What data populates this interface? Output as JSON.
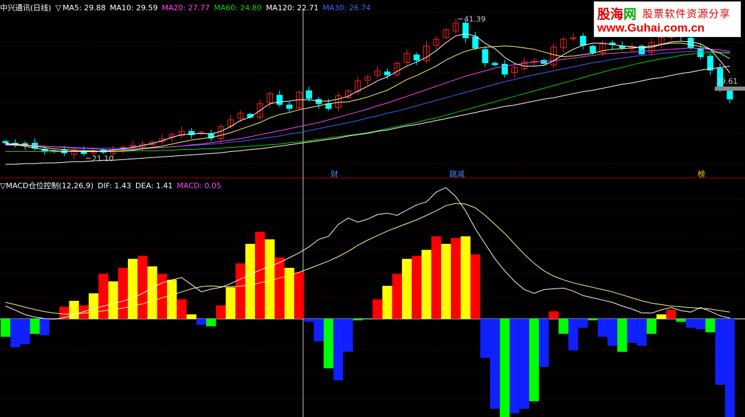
{
  "logo": {
    "brand_a": "股海",
    "brand_b": "网",
    "tagline": "股票软件资源分享",
    "url": "www.Guhai.com.cn"
  },
  "top_header": {
    "title": "中兴通讯(日线)",
    "arrow": "▽",
    "indicators": [
      {
        "label": "MA5: 29.88",
        "color": "#ffffff"
      },
      {
        "label": "MA10: 29.59",
        "color": "#ffffff"
      },
      {
        "label": "MA20: 27.77",
        "color": "#ff44ff"
      },
      {
        "label": "MA60: 24.80",
        "color": "#00dd00"
      },
      {
        "label": "MA120: 22.71",
        "color": "#ffffff"
      },
      {
        "label": "MA30: 26.74",
        "color": "#4466ff"
      }
    ]
  },
  "bottom_header": {
    "arrow": "▽",
    "title": "MACD仓位控制",
    "params": "(12,26,9)",
    "dif": "DIF: 1.43",
    "dea": "DEA: 1.41",
    "macd": "MACD: 0.05",
    "macd_color": "#ff44ff"
  },
  "markers": [
    {
      "text": "财",
      "color": "#4488ff"
    },
    {
      "text": "跳减",
      "color": "#4488ff"
    },
    {
      "text": "榜",
      "color": "#ffcc00"
    }
  ],
  "price_notes": {
    "high": "41.39",
    "low": "21.10",
    "last": "39.61"
  },
  "colors": {
    "up": "#ff2020",
    "down": "#00ffff",
    "hist_up_a": "#ff0000",
    "hist_up_b": "#ffff00",
    "hist_dn_a": "#1020ff",
    "hist_dn_b": "#00ff00",
    "ma5": "#ffffff",
    "ma10": "#ffff66",
    "ma20": "#ff44ff",
    "ma30": "#4466ff",
    "ma60": "#00dd00",
    "ma120": "#ffffff",
    "grid": "#8a0000"
  },
  "chart_data": [
    {
      "type": "candlestick",
      "title": "中兴通讯(日线)",
      "ylim": [
        19.5,
        43.0
      ],
      "close": [
        23.2,
        23.0,
        22.9,
        22.4,
        22.0,
        21.9,
        21.7,
        22.0,
        21.6,
        21.9,
        21.8,
        22.2,
        22.5,
        22.8,
        23.0,
        23.3,
        23.8,
        24.4,
        24.9,
        24.4,
        24.8,
        23.9,
        25.6,
        26.6,
        27.6,
        27.0,
        29.0,
        30.5,
        28.9,
        28.3,
        30.7,
        29.8,
        29.0,
        28.3,
        30.2,
        30.9,
        32.4,
        33.0,
        33.9,
        33.3,
        35.0,
        36.5,
        35.5,
        37.6,
        38.6,
        40.0,
        41.0,
        38.8,
        37.3,
        35.1,
        34.8,
        33.4,
        34.4,
        35.2,
        35.3,
        35.0,
        37.4,
        38.6,
        38.8,
        37.7,
        36.6,
        37.9,
        37.8,
        37.3,
        37.5,
        36.4,
        38.1,
        38.9,
        39.0,
        39.0,
        37.3,
        36.0,
        34.0,
        31.1,
        29.7
      ],
      "ma5": [
        23.0,
        22.9,
        22.7,
        22.4,
        22.2,
        22.0,
        21.9,
        21.9,
        21.9,
        21.9,
        21.9,
        22.1,
        22.3,
        22.5,
        22.8,
        23.1,
        23.5,
        24.0,
        24.4,
        24.5,
        24.6,
        24.5,
        24.9,
        25.6,
        26.5,
        27.0,
        28.0,
        29.0,
        29.3,
        29.4,
        29.6,
        29.6,
        29.4,
        29.4,
        29.7,
        30.1,
        30.9,
        31.6,
        32.4,
        33.0,
        33.8,
        34.6,
        35.2,
        35.9,
        36.9,
        38.1,
        39.1,
        39.4,
        39.1,
        38.0,
        37.2,
        35.9,
        35.0,
        34.6,
        34.6,
        34.7,
        35.4,
        36.3,
        37.1,
        37.7,
        38.0,
        38.0,
        37.8,
        37.6,
        37.5,
        37.3,
        37.4,
        37.8,
        38.2,
        38.3,
        38.2,
        37.9,
        37.1,
        35.4,
        33.6
      ],
      "ma10": [
        23.1,
        23.0,
        22.9,
        22.7,
        22.5,
        22.3,
        22.2,
        22.1,
        22.0,
        22.0,
        21.9,
        21.9,
        22.0,
        22.1,
        22.3,
        22.5,
        22.7,
        23.0,
        23.3,
        23.6,
        23.8,
        24.0,
        24.3,
        24.7,
        25.2,
        25.7,
        26.2,
        26.9,
        27.4,
        27.7,
        28.1,
        28.4,
        28.7,
        29.0,
        29.2,
        29.3,
        29.6,
        30.0,
        30.5,
        31.0,
        31.8,
        32.6,
        33.2,
        33.9,
        34.6,
        35.5,
        36.2,
        36.8,
        37.2,
        37.4,
        37.5,
        37.6,
        37.5,
        37.3,
        37.1,
        36.7,
        36.3,
        36.0,
        36.1,
        36.3,
        36.5,
        36.9,
        37.1,
        37.2,
        37.3,
        37.4,
        37.6,
        37.8,
        38.0,
        38.0,
        37.8,
        37.5,
        37.1,
        36.5,
        35.7
      ],
      "ma20": [
        22.9,
        22.9,
        22.8,
        22.8,
        22.7,
        22.6,
        22.5,
        22.4,
        22.3,
        22.3,
        22.2,
        22.2,
        22.2,
        22.2,
        22.3,
        22.4,
        22.5,
        22.6,
        22.7,
        22.9,
        23.0,
        23.2,
        23.4,
        23.6,
        23.8,
        24.1,
        24.4,
        24.7,
        25.0,
        25.3,
        25.6,
        25.9,
        26.2,
        26.6,
        27.0,
        27.4,
        27.8,
        28.2,
        28.7,
        29.1,
        29.6,
        30.1,
        30.6,
        31.1,
        31.6,
        32.1,
        32.6,
        33.1,
        33.5,
        33.9,
        34.3,
        34.6,
        34.8,
        35.0,
        35.2,
        35.3,
        35.4,
        35.6,
        35.8,
        36.0,
        36.2,
        36.4,
        36.5,
        36.6,
        36.7,
        36.8,
        36.9,
        37.0,
        37.1,
        37.2,
        37.3,
        37.2,
        37.1,
        37.0,
        36.8
      ],
      "ma30": [
        22.8,
        22.8,
        22.8,
        22.7,
        22.7,
        22.6,
        22.6,
        22.5,
        22.5,
        22.4,
        22.4,
        22.4,
        22.4,
        22.4,
        22.4,
        22.5,
        22.5,
        22.6,
        22.7,
        22.8,
        22.9,
        23.0,
        23.1,
        23.3,
        23.4,
        23.6,
        23.8,
        24.0,
        24.2,
        24.5,
        24.7,
        25.0,
        25.3,
        25.6,
        25.9,
        26.2,
        26.5,
        26.9,
        27.2,
        27.6,
        27.9,
        28.3,
        28.7,
        29.1,
        29.5,
        29.9,
        30.3,
        30.7,
        31.1,
        31.5,
        31.9,
        32.3,
        32.6,
        33.0,
        33.3,
        33.6,
        33.9,
        34.2,
        34.5,
        34.8,
        35.1,
        35.3,
        35.6,
        35.8,
        36.0,
        36.2,
        36.3,
        36.5,
        36.6,
        36.7,
        36.8,
        36.8,
        36.8,
        36.7,
        36.6
      ],
      "ma60": [
        21.9,
        21.9,
        21.9,
        21.9,
        21.9,
        21.9,
        21.9,
        21.9,
        21.9,
        21.9,
        21.9,
        21.9,
        21.9,
        22.0,
        22.0,
        22.0,
        22.1,
        22.1,
        22.2,
        22.2,
        22.3,
        22.3,
        22.4,
        22.5,
        22.6,
        22.7,
        22.8,
        22.9,
        23.0,
        23.2,
        23.3,
        23.5,
        23.7,
        23.9,
        24.1,
        24.3,
        24.5,
        24.7,
        25.0,
        25.3,
        25.6,
        25.9,
        26.2,
        26.6,
        26.9,
        27.3,
        27.7,
        28.1,
        28.5,
        28.9,
        29.3,
        29.7,
        30.1,
        30.5,
        30.9,
        31.3,
        31.7,
        32.1,
        32.5,
        32.9,
        33.3,
        33.7,
        34.1,
        34.4,
        34.8,
        35.1,
        35.4,
        35.7,
        35.9,
        36.2,
        36.4,
        36.5,
        36.6,
        36.6,
        36.5
      ],
      "ma120": [
        20.0,
        20.0,
        20.1,
        20.1,
        20.2,
        20.2,
        20.3,
        20.4,
        20.4,
        20.5,
        20.6,
        20.6,
        20.7,
        20.8,
        20.9,
        21.0,
        21.1,
        21.2,
        21.3,
        21.4,
        21.5,
        21.6,
        21.7,
        21.9,
        22.0,
        22.2,
        22.3,
        22.5,
        22.7,
        22.9,
        23.1,
        23.3,
        23.5,
        23.7,
        23.9,
        24.2,
        24.4,
        24.6,
        24.9,
        25.1,
        25.4,
        25.7,
        25.9,
        26.2,
        26.5,
        26.8,
        27.1,
        27.4,
        27.7,
        28.0,
        28.3,
        28.6,
        28.8,
        29.1,
        29.4,
        29.7,
        29.9,
        30.2,
        30.5,
        30.8,
        31.0,
        31.3,
        31.6,
        31.9,
        32.1,
        32.4,
        32.7,
        32.9,
        33.2,
        33.5,
        33.7,
        34.0,
        34.2,
        34.4,
        34.6
      ]
    },
    {
      "type": "bar",
      "title": "MACD仓位控制",
      "ylim": [
        -6.5,
        8.8
      ],
      "hist": [
        -1.2,
        -1.9,
        -1.7,
        -1.0,
        -1.1,
        0.0,
        0.8,
        1.2,
        0.9,
        1.7,
        3.0,
        2.5,
        3.4,
        4.0,
        4.2,
        3.5,
        3.0,
        2.6,
        1.3,
        0.3,
        -0.4,
        -0.5,
        0.9,
        2.1,
        3.7,
        5.0,
        5.8,
        5.3,
        4.1,
        3.4,
        3.1,
        -0.2,
        -1.5,
        -3.3,
        -4.1,
        -2.2,
        -0.1,
        0.0,
        1.3,
        2.2,
        3.0,
        4.0,
        4.2,
        4.6,
        5.5,
        5.0,
        5.4,
        5.5,
        4.3,
        -2.6,
        -6.0,
        -7.8,
        -6.3,
        -6.0,
        -5.5,
        -3.2,
        0.5,
        -1.0,
        -2.1,
        -0.6,
        -0.1,
        -1.2,
        -1.8,
        -2.2,
        -1.6,
        -1.8,
        -1.0,
        0.3,
        0.6,
        -0.2,
        -0.6,
        -0.7,
        -0.9,
        -4.4,
        -7.9
      ],
      "dif": [
        0.85,
        0.58,
        0.28,
        0.12,
        0.02,
        -0.02,
        0.08,
        0.28,
        0.48,
        0.68,
        0.85,
        1.02,
        1.18,
        1.4,
        1.7,
        2.05,
        2.4,
        2.6,
        2.75,
        2.28,
        1.8,
        1.98,
        2.1,
        2.35,
        2.65,
        2.95,
        3.25,
        3.5,
        3.75,
        4.08,
        4.4,
        4.8,
        5.3,
        5.5,
        6.3,
        6.72,
        6.45,
        6.65,
        6.95,
        7.05,
        6.9,
        7.25,
        7.6,
        7.8,
        8.45,
        8.75,
        8.15,
        7.2,
        6.0,
        5.0,
        4.0,
        3.2,
        2.5,
        1.95,
        1.7,
        1.95,
        2.0,
        2.05,
        1.85,
        1.55,
        1.4,
        1.25,
        1.1,
        0.85,
        0.65,
        0.4,
        0.38,
        0.6,
        0.75,
        0.55,
        0.45,
        0.75,
        0.5,
        0.2,
        0.05
      ],
      "dea": [
        1.1,
        0.95,
        0.78,
        0.62,
        0.48,
        0.38,
        0.32,
        0.32,
        0.37,
        0.45,
        0.53,
        0.62,
        0.72,
        0.85,
        1.0,
        1.2,
        1.4,
        1.6,
        1.8,
        2.0,
        2.15,
        2.2,
        2.15,
        2.15,
        2.18,
        2.25,
        2.4,
        2.55,
        2.72,
        2.9,
        3.1,
        3.35,
        3.6,
        3.85,
        4.15,
        4.5,
        4.9,
        5.25,
        5.55,
        5.85,
        6.1,
        6.35,
        6.6,
        6.9,
        7.2,
        7.55,
        7.7,
        7.65,
        7.4,
        6.9,
        6.3,
        5.7,
        5.0,
        4.3,
        3.7,
        3.2,
        2.85,
        2.6,
        2.4,
        2.25,
        2.1,
        1.95,
        1.8,
        1.6,
        1.4,
        1.2,
        1.05,
        0.95,
        0.85,
        0.8,
        0.75,
        0.7,
        0.65,
        0.55,
        0.45
      ]
    }
  ]
}
